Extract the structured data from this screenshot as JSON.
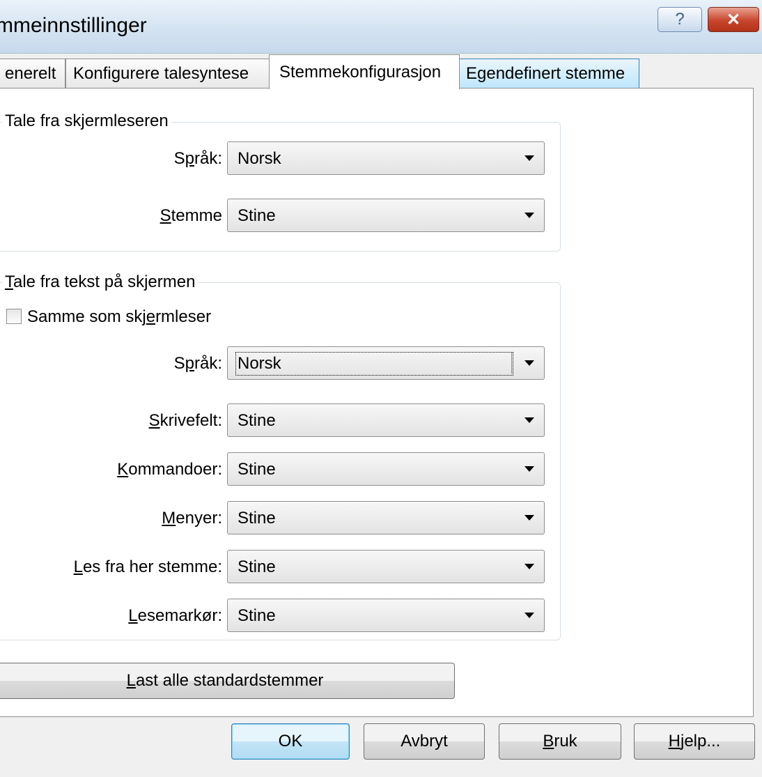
{
  "window": {
    "title": "mmeinnstillinger",
    "help_glyph": "?",
    "close_glyph": "✕"
  },
  "tabs": [
    {
      "label": "enerelt",
      "active": false
    },
    {
      "label": "Konfigurere talesyntese",
      "active": false
    },
    {
      "label": "Stemmekonfigurasjon",
      "active": true
    },
    {
      "label": "Egendefinert stemme",
      "active": false
    }
  ],
  "group_screenreader": {
    "title": "Tale fra skjermleseren",
    "language": {
      "label_pre": "S",
      "label_u": "p",
      "label_post": "råk:",
      "value": "Norsk"
    },
    "voice": {
      "label_pre": "",
      "label_u": "S",
      "label_post": "temme",
      "value": "Stine"
    }
  },
  "group_screentext": {
    "title_u": "T",
    "title_rest": "ale fra tekst på skjermen",
    "same_as": {
      "label_pre": "Samme som skj",
      "label_u": "e",
      "label_post": "rmleser",
      "checked": false
    },
    "language": {
      "label_pre": "S",
      "label_u": "p",
      "label_post": "råk:",
      "value": "Norsk"
    },
    "rows": [
      {
        "key": "skrivefelt",
        "label_u": "S",
        "label_post": "krivefelt:",
        "value": "Stine"
      },
      {
        "key": "kommandoer",
        "label_u": "K",
        "label_post": "ommandoer:",
        "value": "Stine"
      },
      {
        "key": "menyer",
        "label_u": "M",
        "label_post": "enyer:",
        "value": "Stine"
      },
      {
        "key": "les-fra-her",
        "label_u": "L",
        "label_post": "es fra her stemme:",
        "value": "Stine"
      },
      {
        "key": "lesemarkor",
        "label_u": "L",
        "label_post": "esemarkør:",
        "value": "Stine"
      }
    ]
  },
  "load_defaults": {
    "label_u": "L",
    "label_post": "ast alle standardstemmer"
  },
  "footer": {
    "ok": "OK",
    "cancel": "Avbryt",
    "apply_u": "B",
    "apply_post": "ruk",
    "help_u": "H",
    "help_post": "jelp..."
  }
}
